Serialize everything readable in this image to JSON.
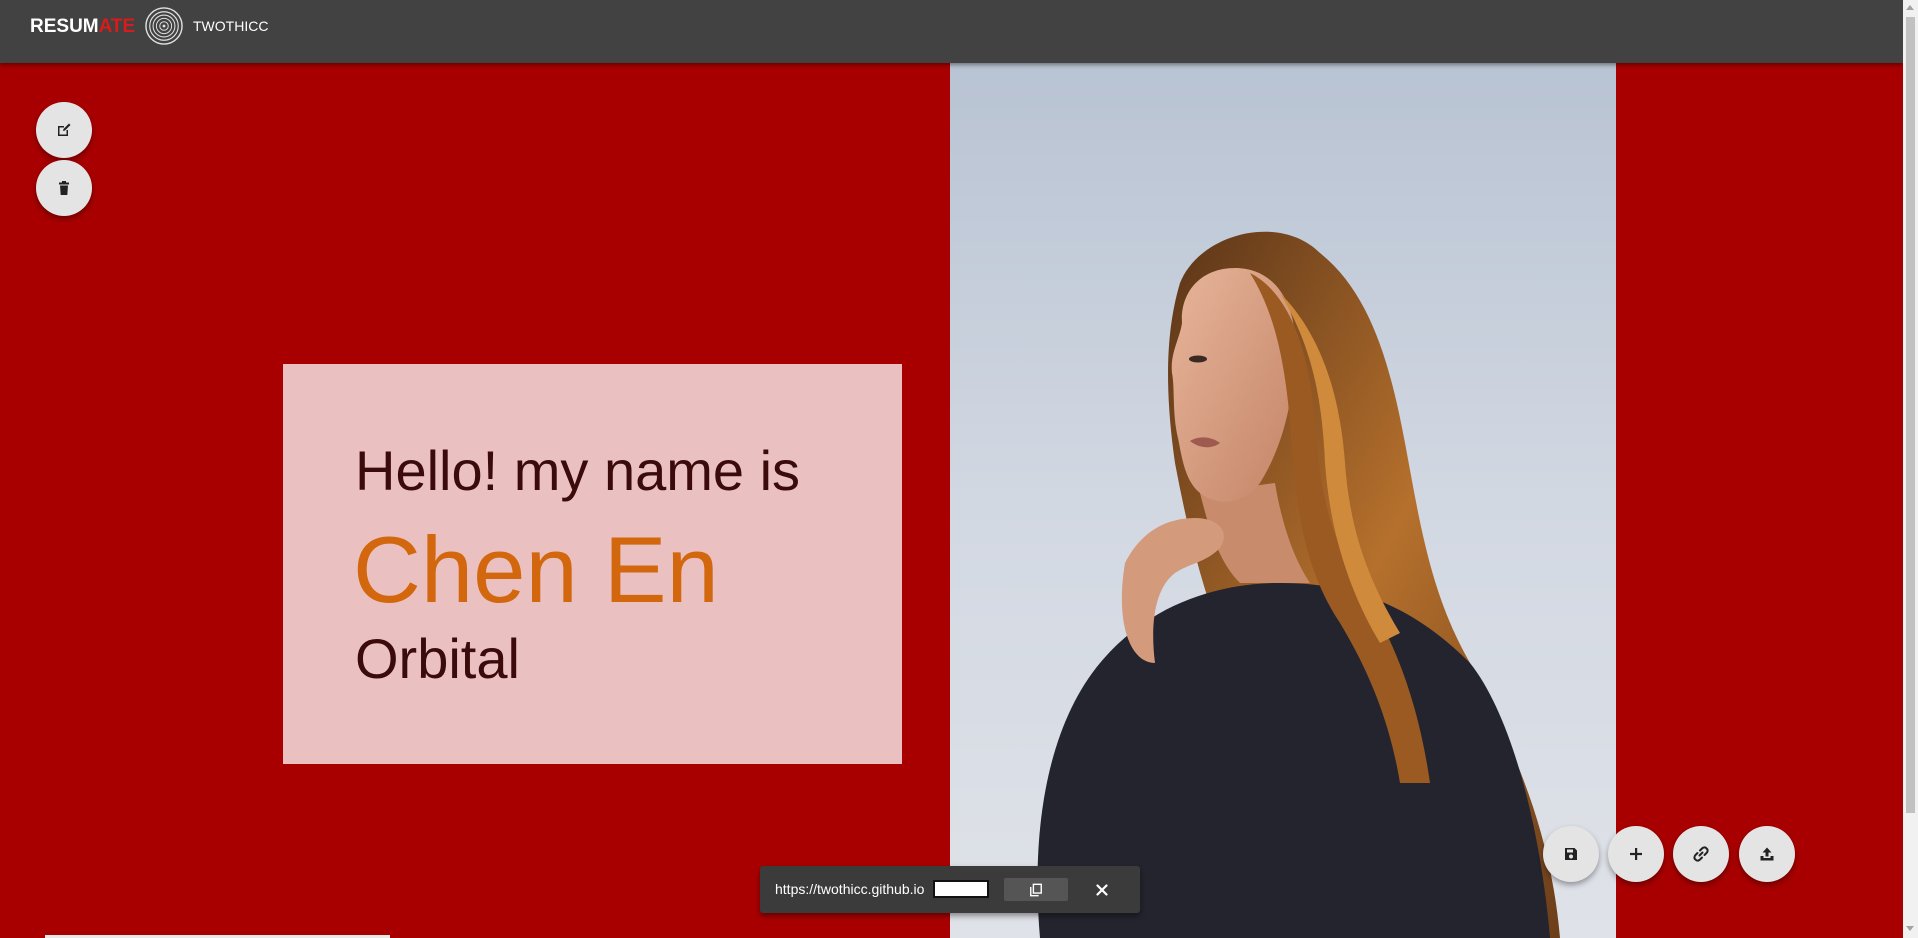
{
  "header": {
    "brand_main": "RESUM",
    "brand_accent": "ATE",
    "team_name": "TWOTHICC",
    "logo_icon": "concentric-circles-logo"
  },
  "intro": {
    "greeting": "Hello! my name is",
    "name": "Chen En",
    "subtitle": "Orbital"
  },
  "left_actions": [
    {
      "icon": "edit-icon",
      "label": "edit"
    },
    {
      "icon": "trash-icon",
      "label": "delete"
    }
  ],
  "right_actions": [
    {
      "icon": "save-icon",
      "label": "save"
    },
    {
      "icon": "plus-icon",
      "label": "add"
    },
    {
      "icon": "link-icon",
      "label": "link"
    },
    {
      "icon": "upload-icon",
      "label": "upload"
    }
  ],
  "share": {
    "url": "https://twothicc.github.io"
  },
  "colors": {
    "topbar": "#424242",
    "background": "#a80000",
    "card": "#ebc0c1",
    "name_accent": "#d2670e",
    "brand_accent": "#d81b1b"
  }
}
